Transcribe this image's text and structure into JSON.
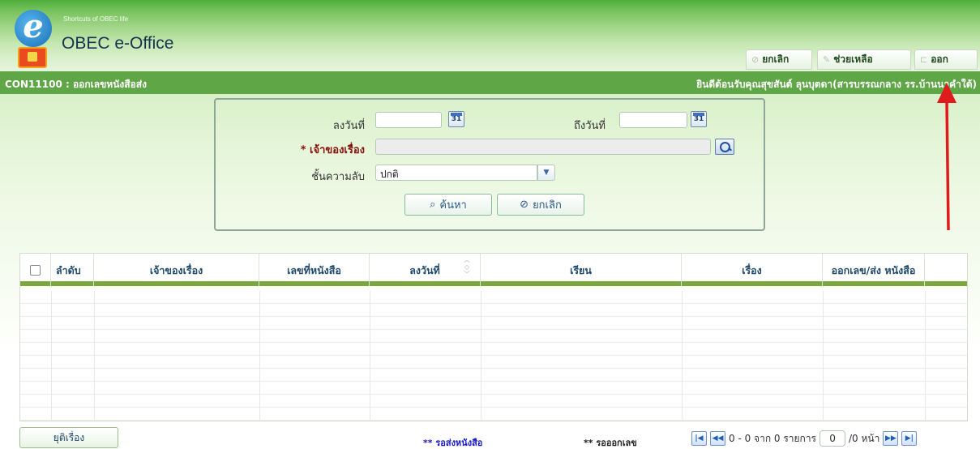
{
  "header": {
    "tagline": "Shortcuts of OBEC life",
    "app_title": "OBEC e-Office",
    "nav": {
      "cancel": "ยกเลิก",
      "help": "ช่วยเหลือ",
      "exit": "ออก"
    }
  },
  "titlebar": {
    "code": "CON11100 : ออกเลขหนังสือส่ง",
    "welcome": "ยินดีต้อนรับคุณสุขสันต์ ลุนบุตดา(สารบรรณกลาง รร.บ้านนาคำใต้)"
  },
  "search": {
    "date_from_label": "ลงวันที่",
    "date_from_value": "",
    "date_to_label": "ถึงวันที่",
    "date_to_value": "",
    "calendar_glyph": "31",
    "owner_label": "* เจ้าของเรื่อง",
    "owner_value": "",
    "secrecy_label": "ชั้นความลับ",
    "secrecy_value": "ปกติ",
    "search_button": "ค้นหา",
    "cancel_button": "ยกเลิก"
  },
  "table": {
    "columns": [
      "ลำดับ",
      "เจ้าของเรื่อง",
      "เลขที่หนังสือ",
      "ลงวันที่",
      "เรียน",
      "เรื่อง",
      "ออกเลข/ส่ง หนังสือ"
    ],
    "rows": []
  },
  "footer": {
    "close_button": "ยุติเรื่อง",
    "legend_pending_send": "** รอส่งหนังสือ",
    "legend_pending_number": "** รอออกเลข",
    "pager_summary": "0 - 0 จาก 0 รายการ",
    "page_input": "0",
    "page_total": "/0 หน้า"
  },
  "colors": {
    "header_green": "#5fa646",
    "legend_send": "#1a1ac8",
    "legend_number": "#222222",
    "arrow": "#e01b1b"
  },
  "icons": {
    "cancel": "cancel-circle-icon",
    "help": "wrench-icon",
    "exit": "exit-icon",
    "search": "search-icon",
    "calendar": "calendar-icon",
    "lookup": "lookup-icon",
    "first": "first-page-icon",
    "prev": "prev-page-icon",
    "next": "next-page-icon",
    "last": "last-page-icon"
  }
}
